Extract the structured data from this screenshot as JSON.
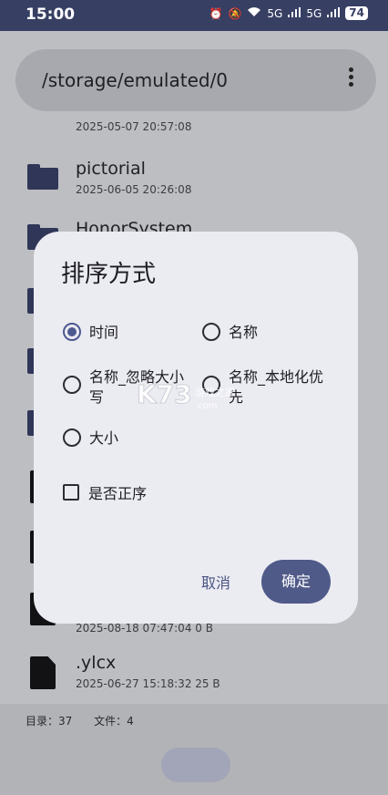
{
  "status_bar": {
    "time": "15:00",
    "network1": "5G",
    "network2": "5G",
    "battery": "74"
  },
  "path_bar": {
    "path": "/storage/emulated/0"
  },
  "files": [
    {
      "name": "",
      "meta": "2025-05-07 20:57:08",
      "type": "folder"
    },
    {
      "name": "pictorial",
      "meta": "2025-06-05 20:26:08",
      "type": "folder"
    },
    {
      "name": "HonorSystem",
      "meta": "",
      "type": "folder"
    },
    {
      "name": "",
      "meta": "2025-08-18 07:47:04    0 B",
      "type": "doc"
    },
    {
      "name": ".ylcx",
      "meta": "2025-06-27 15:18:32    25 B",
      "type": "doc"
    }
  ],
  "footer": {
    "dirs": "目录：37",
    "files": "文件：4"
  },
  "dialog": {
    "title": "排序方式",
    "options": [
      {
        "label": "时间",
        "selected": true
      },
      {
        "label": "名称",
        "selected": false
      },
      {
        "label": "名称_忽略大小写",
        "selected": false
      },
      {
        "label": "名称_本地化优先",
        "selected": false
      },
      {
        "label": "大小",
        "selected": false
      }
    ],
    "checkbox": {
      "label": "是否正序",
      "checked": false
    },
    "cancel": "取消",
    "ok": "确定"
  },
  "watermark": {
    "brand": "K73",
    "sub1": "游戏之家",
    "sub2": ".com"
  },
  "colors": {
    "accent": "#4f5a88",
    "status_bar": "#373f63"
  }
}
